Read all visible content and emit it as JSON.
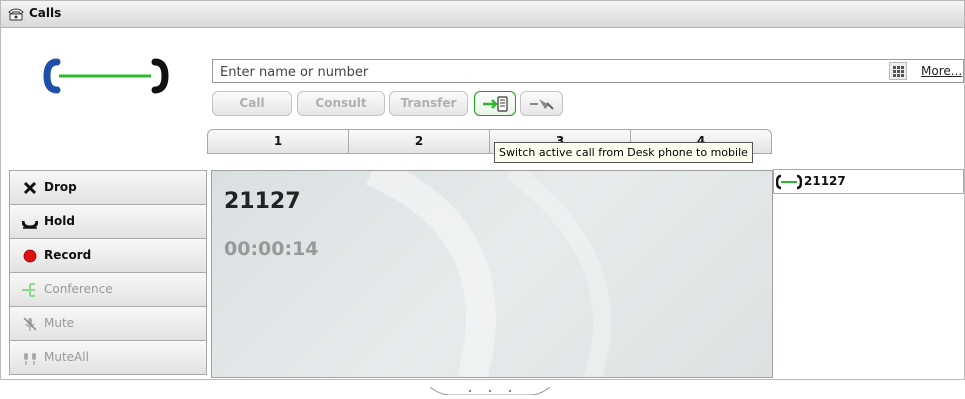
{
  "window": {
    "title": "Calls",
    "title_icon": "telephone-icon"
  },
  "search": {
    "placeholder": "Enter name or number",
    "value": "",
    "more_label": "More..."
  },
  "actions": {
    "call_label": "Call",
    "consult_label": "Consult",
    "transfer_label": "Transfer",
    "switch_icon": "switch-to-mobile-icon",
    "park_icon": "park-call-icon"
  },
  "tabs": [
    "1",
    "2",
    "3",
    "4"
  ],
  "tooltip": "Switch active call from Desk phone to mobile",
  "controls": [
    {
      "label": "Drop",
      "icon": "x-icon",
      "enabled": true
    },
    {
      "label": "Hold",
      "icon": "hold-icon",
      "enabled": true
    },
    {
      "label": "Record",
      "icon": "record-icon",
      "enabled": true
    },
    {
      "label": "Conference",
      "icon": "conference-icon",
      "enabled": false
    },
    {
      "label": "Mute",
      "icon": "mute-icon",
      "enabled": false
    },
    {
      "label": "MuteAll",
      "icon": "mute-all-icon",
      "enabled": false
    }
  ],
  "active_call": {
    "number": "21127",
    "duration": "00:00:14"
  },
  "call_list": [
    {
      "number": "21127",
      "icon": "active-call-icon"
    }
  ],
  "colors": {
    "connected_line": "#2fb82f",
    "handset": "#1f4fa8",
    "record": "#e01010"
  }
}
